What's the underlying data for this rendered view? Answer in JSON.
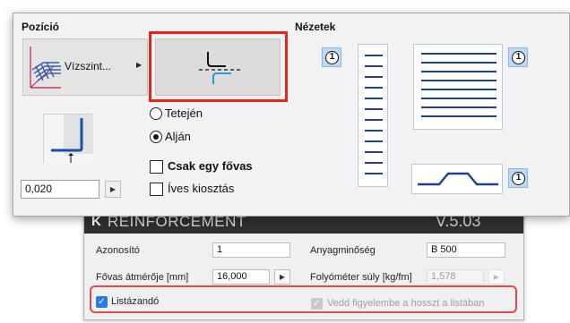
{
  "popup": {
    "position_title": "Pozíció",
    "views_title": "Nézetek",
    "direction_button": "Vízszint...",
    "radio_top": "Tetején",
    "radio_bottom": "Alján",
    "radio_selected": "bottom",
    "checkbox_single_bar": "Csak egy fővas",
    "checkbox_arc": "Íves kiosztás",
    "offset_value": "0,020",
    "view_number_1": "1",
    "view_number_2": "1",
    "view_number_3": "1",
    "highlight_color": "#e2261c"
  },
  "reinforcement": {
    "logo": "K",
    "title": "REINFORCEMENT",
    "version": "V.5.03",
    "id_label": "Azonosító",
    "id_value": "1",
    "material_label": "Anyagminőség",
    "material_value": "B 500",
    "diameter_label": "Fővas átmérője [mm]",
    "diameter_value": "16,000",
    "weight_label": "Folyóméter súly [kg/fm]",
    "weight_value": "1,578",
    "listed_label": "Listázandó",
    "listed_checked": true,
    "consider_length_label": "Vedd figyelembe a hosszt a listában",
    "consider_length_checked": true,
    "accent_color": "#2b7de1"
  }
}
